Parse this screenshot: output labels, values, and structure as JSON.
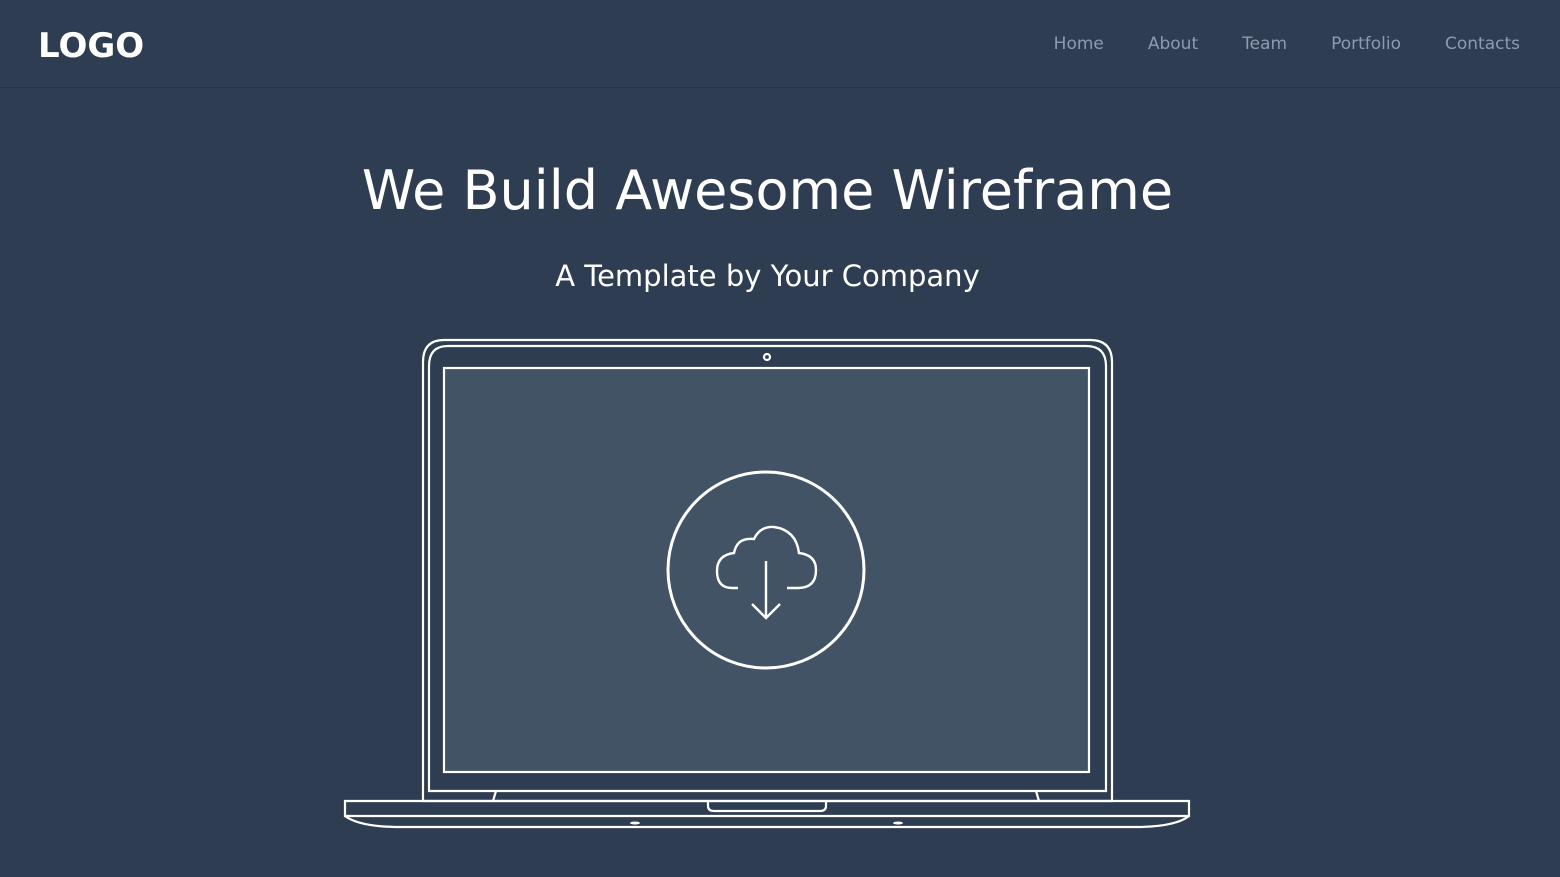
{
  "header": {
    "logo": "LOGO",
    "nav": [
      {
        "label": "Home"
      },
      {
        "label": "About"
      },
      {
        "label": "Team"
      },
      {
        "label": "Portfolio"
      },
      {
        "label": "Contacts"
      }
    ]
  },
  "hero": {
    "title": "We Build Awesome Wireframe",
    "subtitle": "A Template by Your Company"
  },
  "illustration": {
    "device": "laptop-outline",
    "screen_icon": "cloud-download-icon"
  },
  "colors": {
    "background": "#2e3d51",
    "screen": "#435366",
    "nav_text": "#8b9bb0",
    "line": "#ffffff"
  }
}
